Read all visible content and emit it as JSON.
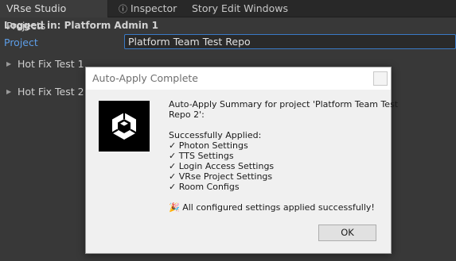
{
  "tabs": [
    {
      "label": "VRse Studio Projects",
      "active": true,
      "icon": ""
    },
    {
      "label": "Inspector",
      "active": false,
      "icon": "info-icon"
    },
    {
      "label": "Story Edit Windows",
      "active": false,
      "icon": ""
    }
  ],
  "main": {
    "logged_in": "Logged in: Platform Admin 1",
    "project_label": "Project",
    "project_value": "Platform Team Test Repo",
    "foldouts": [
      "Hot Fix Test 1",
      "Hot Fix Test 2"
    ]
  },
  "dialog": {
    "title": "Auto-Apply Complete",
    "summary_line1": "Auto-Apply Summary for project 'Platform Team Test",
    "summary_line2": "Repo 2':",
    "applied_header": "Successfully Applied:",
    "applied_items": [
      "✓ Photon Settings",
      "✓ TTS Settings",
      "✓ Login Access Settings",
      "✓ VRse Project Settings",
      "✓ Room Configs"
    ],
    "success_message": "🎉 All configured settings applied successfully!",
    "ok_label": "OK",
    "logo_icon": "unity-logo-icon"
  },
  "colors": {
    "background": "#383838",
    "accent_blue": "#5d9ee8",
    "field_border": "#3a7ac6"
  }
}
